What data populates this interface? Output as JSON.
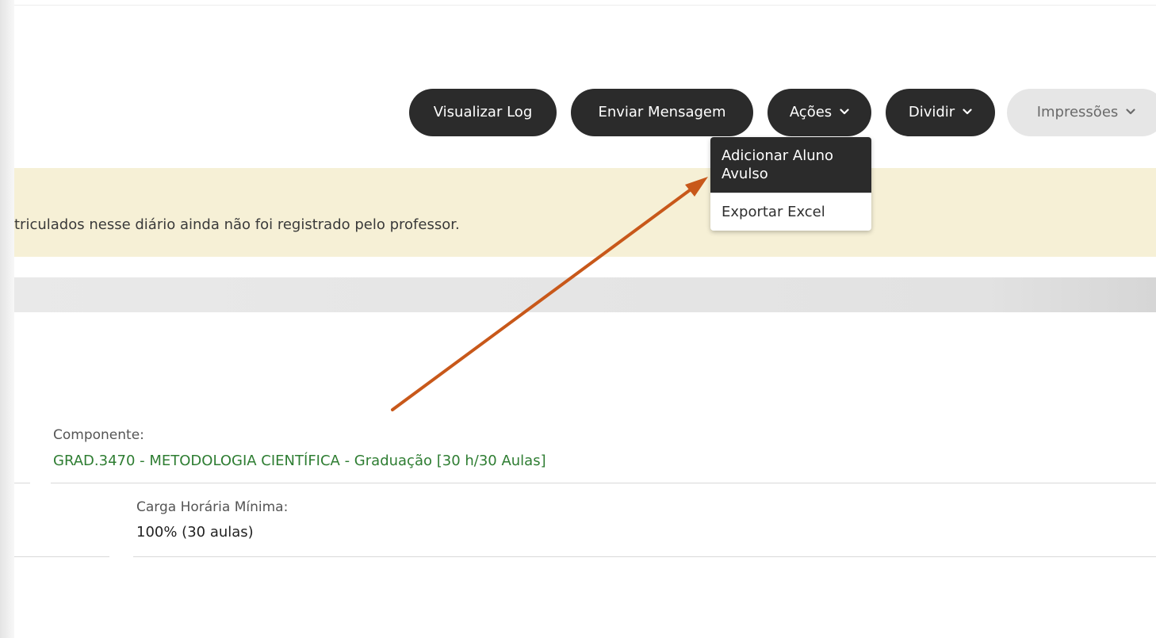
{
  "toolbar": {
    "log_label": "Visualizar Log",
    "message_label": "Enviar Mensagem",
    "actions_label": "Ações",
    "split_label": "Dividir",
    "prints_label": "Impressões"
  },
  "actions_menu": {
    "items": [
      "Adicionar Aluno Avulso",
      "Exportar Excel"
    ]
  },
  "warning": {
    "text": "triculados nesse diário ainda não foi registrado pelo professor."
  },
  "details": {
    "component_label": "Componente:",
    "component_value": "GRAD.3470 - METODOLOGIA CIENTÍFICA - Graduação [30 h/30 Aulas]",
    "min_workload_label": "Carga Horária Mínima:",
    "min_workload_value": "100% (30 aulas)"
  },
  "colors": {
    "button_dark": "#2b2b2b",
    "button_light": "#e6e6e6",
    "warning_bg": "#f6f0d6",
    "component_value_green": "#2e7d32",
    "annotation_arrow": "#c8581a"
  },
  "icons": {
    "dropdown_chevron": "chevron-down-icon"
  }
}
